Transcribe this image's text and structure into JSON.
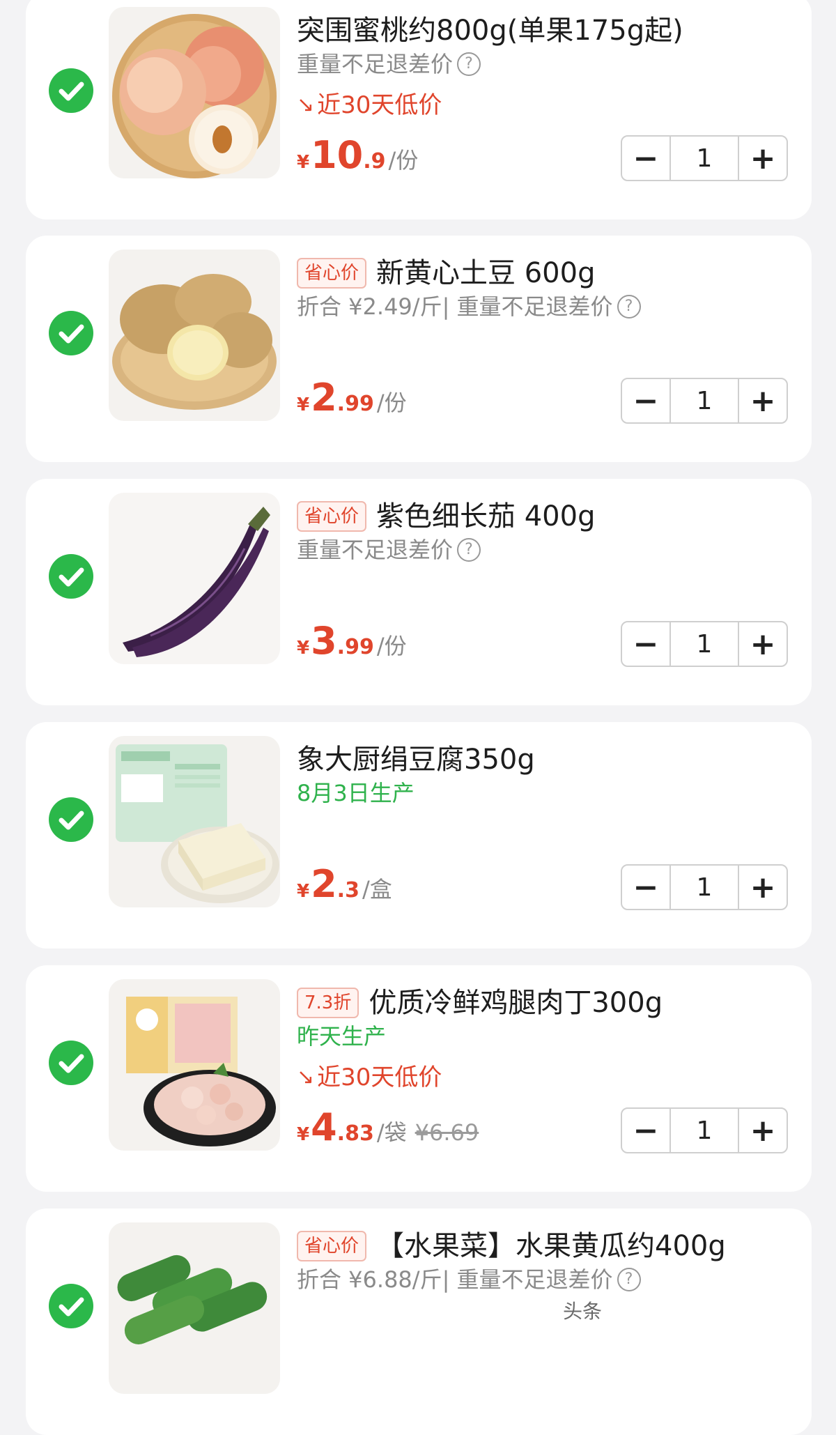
{
  "items": [
    {
      "title": "突围蜜桃约800g(单果175g起)",
      "sub": "重量不足退差价",
      "low_price": "近30天低价",
      "price_yen": "¥",
      "price_int": "10",
      "price_dec": ".9",
      "price_unit": "/份",
      "qty": "1",
      "image": "peach-image"
    },
    {
      "tag": "省心价",
      "title": "新黄心土豆 600g",
      "sub": "折合 ¥2.49/斤| 重量不足退差价",
      "price_yen": "¥",
      "price_int": "2",
      "price_dec": ".99",
      "price_unit": "/份",
      "qty": "1",
      "image": "potato-image"
    },
    {
      "tag": "省心价",
      "title": "紫色细长茄 400g",
      "sub": "重量不足退差价",
      "price_yen": "¥",
      "price_int": "3",
      "price_dec": ".99",
      "price_unit": "/份",
      "qty": "1",
      "image": "eggplant-image"
    },
    {
      "title": "象大厨绢豆腐350g",
      "sub_green": "8月3日生产",
      "price_yen": "¥",
      "price_int": "2",
      "price_dec": ".3",
      "price_unit": "/盒",
      "qty": "1",
      "image": "tofu-image"
    },
    {
      "tag": "7.3折",
      "title": "优质冷鲜鸡腿肉丁300g",
      "sub_green": "昨天生产",
      "low_price": "近30天低价",
      "price_yen": "¥",
      "price_int": "4",
      "price_dec": ".83",
      "price_unit": "/袋",
      "price_old": "¥6.69",
      "qty": "1",
      "image": "chicken-image"
    },
    {
      "tag": "省心价",
      "title": "【水果菜】水果黄瓜约400g",
      "sub": "折合 ¥6.88/斤| 重量不足退差价",
      "image": "cucumber-image"
    }
  ],
  "stepper": {
    "minus": "−",
    "plus": "+"
  },
  "low_price_icon": "trend-down-icon",
  "help_icon_glyph": "?",
  "watermark": "头条",
  "colors": {
    "accent_red": "#e0452c",
    "check_green": "#2bb84a",
    "fresh_green": "#2fb24c",
    "muted_gray": "#8a8a8a"
  }
}
